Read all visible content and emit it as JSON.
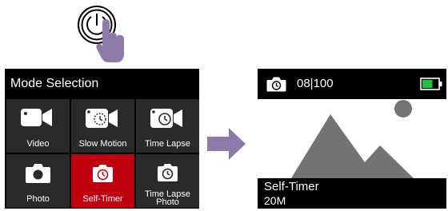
{
  "mode_screen": {
    "title": "Mode Selection",
    "selected_mode": "Self-Timer",
    "modes": [
      {
        "label": "Video",
        "icon": "video-camera-icon"
      },
      {
        "label": "Slow Motion",
        "icon": "slow-motion-icon"
      },
      {
        "label": "Time Lapse",
        "icon": "time-lapse-icon"
      },
      {
        "label": "Photo",
        "icon": "photo-camera-icon"
      },
      {
        "label": "Self-Timer",
        "icon": "self-timer-icon"
      },
      {
        "label_line1": "Time Lapse",
        "label_line2": "Photo",
        "icon": "time-lapse-photo-icon"
      }
    ]
  },
  "camera_screen": {
    "shot_count": "08|100",
    "mode_label": "Self-Timer",
    "resolution": "20M",
    "battery_level": 0.66,
    "icons": [
      "self-timer-icon",
      "battery-icon",
      "mountain-image-icon"
    ]
  },
  "hint_icons": [
    "power-button-icon",
    "pointing-hand-icon",
    "right-arrow-icon"
  ],
  "colors": {
    "screen_bg": "#000000",
    "tile_bg": "#2a2a2a",
    "selected_tile": "#c0000f",
    "hand_and_arrow": "#8e7aa8",
    "battery_green": "#22c33a",
    "preview_gray": "#737373"
  }
}
